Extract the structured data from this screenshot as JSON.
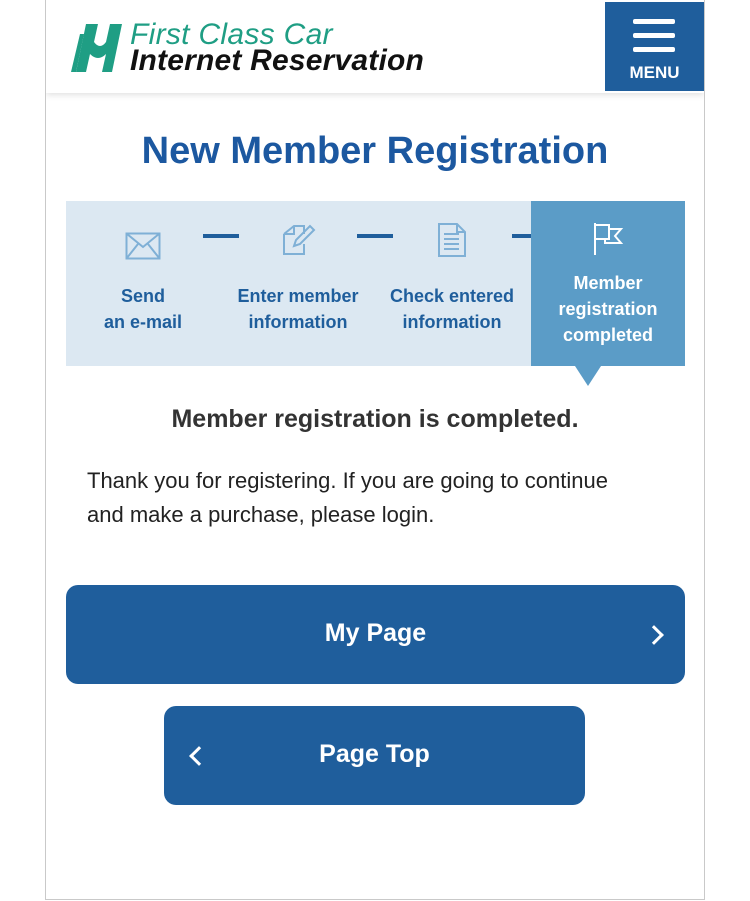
{
  "header": {
    "brand_line1": "First Class Car",
    "brand_line2": "Internet Reservation",
    "logo_icon": "logo-mark",
    "menu_label": "MENU",
    "menu_icon": "hamburger-icon"
  },
  "page": {
    "title": "New Member Registration"
  },
  "steps": [
    {
      "line1": "Send",
      "line2": "an e-mail",
      "icon": "envelope-icon",
      "active": false
    },
    {
      "line1": "Enter member",
      "line2": "information",
      "icon": "edit-icon",
      "active": false
    },
    {
      "line1": "Check entered",
      "line2": "information",
      "icon": "document-icon",
      "active": false
    },
    {
      "line1": "Member",
      "line2": "registration",
      "line3": "completed",
      "icon": "flag-icon",
      "active": true
    }
  ],
  "message": {
    "heading": "Member registration is completed.",
    "body": "Thank you for registering. If you are going to continue and make a purchase, please login."
  },
  "buttons": {
    "my_page": "My Page",
    "page_top": "Page Top"
  },
  "colors": {
    "primary": "#1f5e9c",
    "title": "#1c58a0",
    "step_bg": "#dce8f2",
    "step_active": "#5b9cc7",
    "brand_green": "#1f9e84"
  }
}
